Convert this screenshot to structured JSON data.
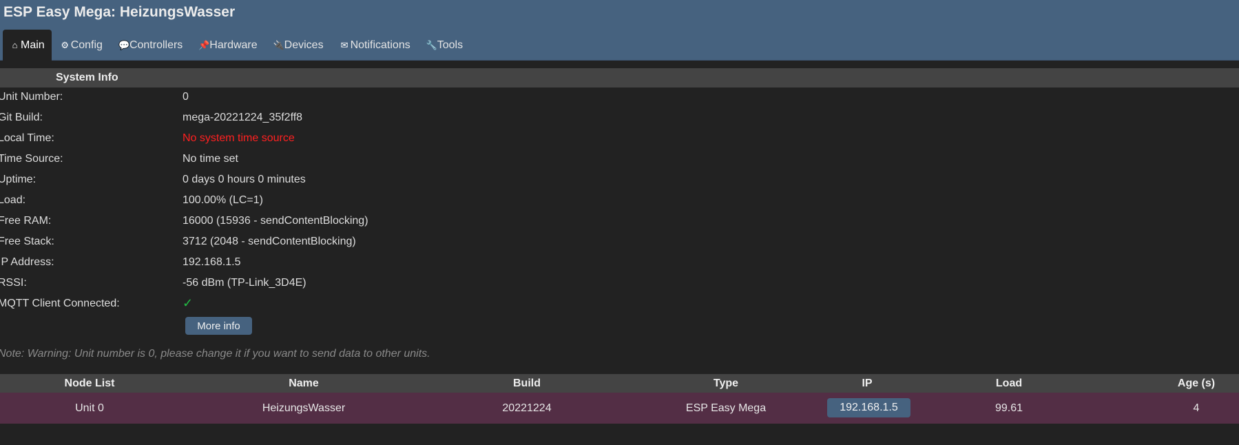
{
  "header": {
    "title": "ESP Easy Mega: HeizungsWasser"
  },
  "menu": {
    "items": [
      {
        "icon": "⌂",
        "label": "Main"
      },
      {
        "icon": "⚙",
        "label": "Config"
      },
      {
        "icon": "💬",
        "label": "Controllers"
      },
      {
        "icon": "📌",
        "label": "Hardware"
      },
      {
        "icon": "🔌",
        "label": "Devices"
      },
      {
        "icon": "✉",
        "label": "Notifications"
      },
      {
        "icon": "🔧",
        "label": "Tools"
      }
    ],
    "active": "Main"
  },
  "system_info": {
    "title": "System Info",
    "rows": [
      {
        "label": "Unit Number:",
        "value": "0"
      },
      {
        "label": "Git Build:",
        "value": "mega-20221224_35f2ff8"
      },
      {
        "label": "Local Time:",
        "value": "No system time source"
      },
      {
        "label": "Time Source:",
        "value": "No time set"
      },
      {
        "label": "Uptime:",
        "value": "0 days 0 hours 0 minutes"
      },
      {
        "label": "Load:",
        "value": "100.00% (LC=1)"
      },
      {
        "label": "Free RAM:",
        "value": "16000 (15936 - sendContentBlocking)"
      },
      {
        "label": "Free Stack:",
        "value": "3712 (2048 - sendContentBlocking)"
      },
      {
        "label": "IP Address:",
        "value": "192.168.1.5"
      },
      {
        "label": "RSSI:",
        "value": "-56 dBm (TP-Link_3D4E)"
      },
      {
        "label": "MQTT Client Connected:",
        "value": "✓"
      }
    ],
    "more_info_label": "More info",
    "note": "Note: Warning: Unit number is 0, please change it if you want to send data to other units."
  },
  "node_list": {
    "headers": [
      "Node List",
      "Name",
      "Build",
      "Type",
      "IP",
      "Load",
      "Age (s)"
    ],
    "rows": [
      [
        "Unit 0",
        "HeizungsWasser",
        "20221224",
        "ESP Easy Mega",
        "192.168.1.5",
        "99.61",
        "4"
      ]
    ]
  },
  "colors": {
    "header_bg": "#46627f",
    "page_bg": "#222222",
    "section_bg": "#444444",
    "node_row_bg": "#532e45",
    "warning_text": "#ff2020",
    "ok_check": "#22bb44"
  }
}
